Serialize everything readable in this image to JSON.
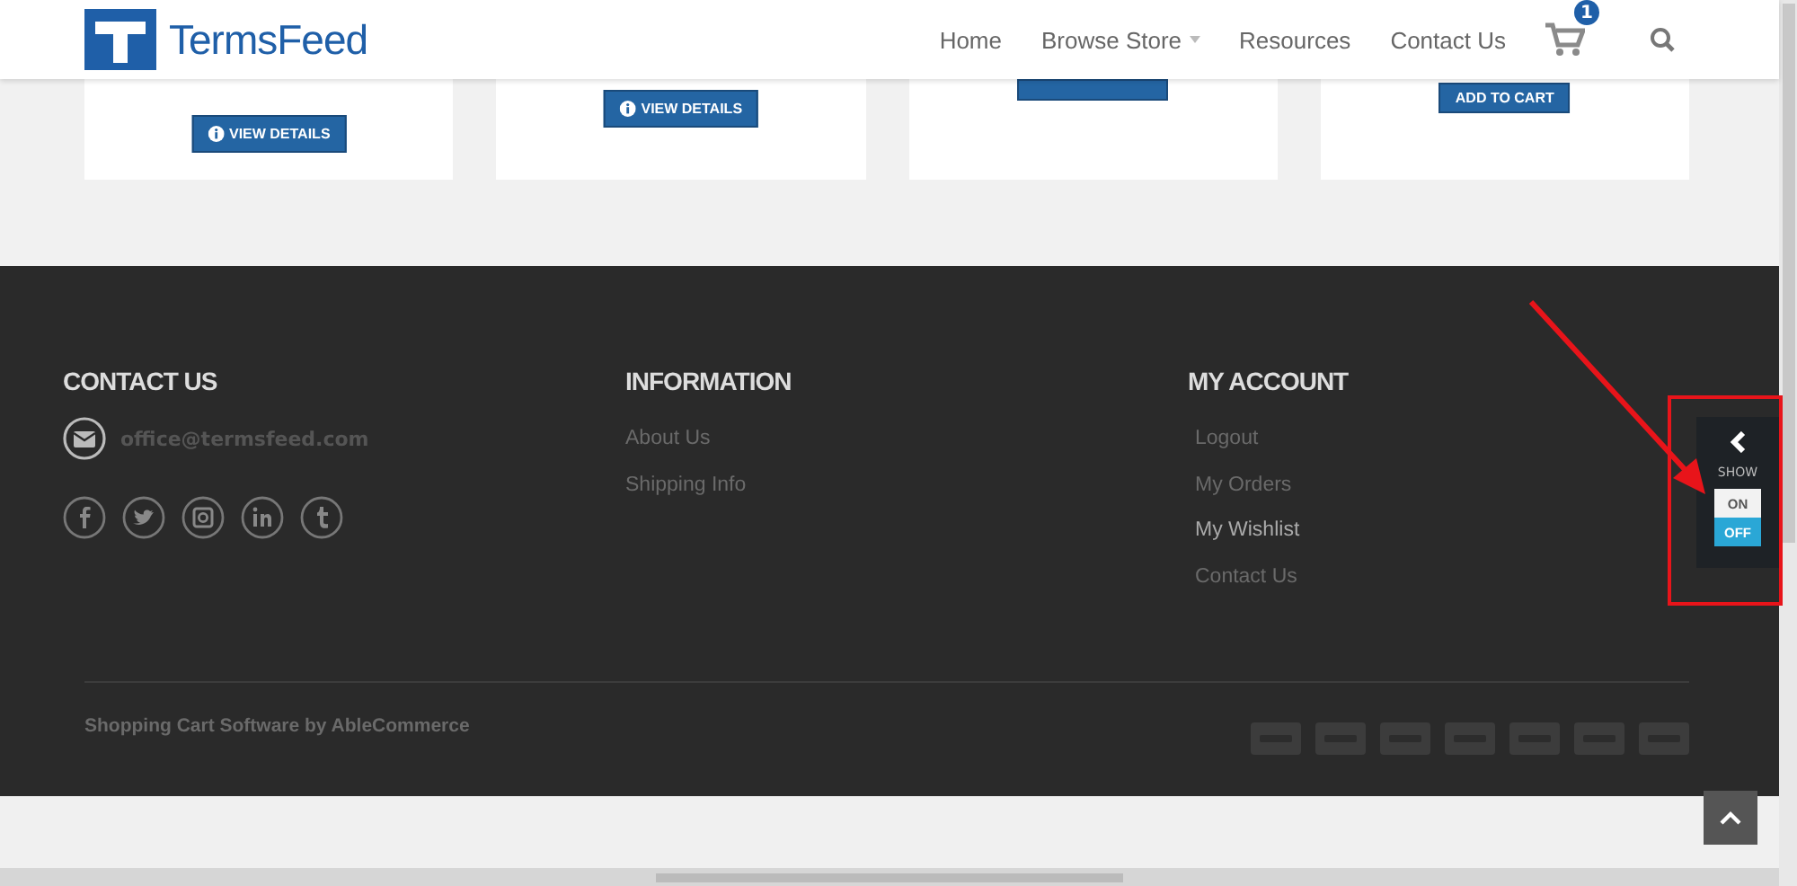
{
  "header": {
    "logo": "TermsFeed",
    "nav": [
      {
        "label": "Home",
        "dropdown": false
      },
      {
        "label": "Browse Store",
        "dropdown": true
      },
      {
        "label": "Resources",
        "dropdown": false
      },
      {
        "label": "Contact Us",
        "dropdown": false
      }
    ],
    "cart_count": "1"
  },
  "products": [
    {
      "button": {
        "kind": "details",
        "label": "VIEW DETAILS"
      }
    },
    {
      "button": {
        "kind": "details",
        "label": "VIEW DETAILS"
      }
    },
    {
      "button": {
        "kind": "hidden"
      }
    },
    {
      "button": {
        "kind": "cart",
        "label": "ADD TO CART"
      }
    }
  ],
  "footer": {
    "contact": {
      "heading": "CONTACT US",
      "email": "office@termsfeed.com"
    },
    "columns": [
      {
        "heading": "INFORMATION",
        "links": [
          {
            "label": "About Us",
            "highlight": false
          },
          {
            "label": "Shipping Info",
            "highlight": false
          }
        ]
      },
      {
        "heading": "MY ACCOUNT",
        "links": [
          {
            "label": "Logout",
            "highlight": false
          },
          {
            "label": "My Orders",
            "highlight": false
          },
          {
            "label": "My Wishlist",
            "highlight": true
          },
          {
            "label": "Contact Us",
            "highlight": false
          }
        ]
      }
    ],
    "credit": "Shopping Cart Software by AbleCommerce"
  },
  "show_panel": {
    "label": "SHOW",
    "options": [
      {
        "label": "ON",
        "selected": false
      },
      {
        "label": "OFF",
        "selected": true
      }
    ]
  }
}
